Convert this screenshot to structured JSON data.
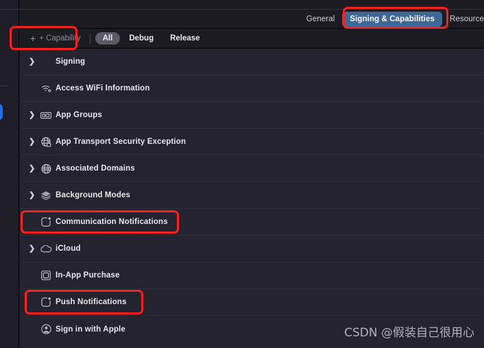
{
  "window": {
    "background_color": "#1c1b22",
    "list_background_color": "#24222e",
    "accent_blue": "#3f6795",
    "annotation_color": "#fb2020"
  },
  "tabbar": {
    "tabs": [
      {
        "label": "General",
        "active": false
      },
      {
        "label": "Signing & Capabilities",
        "active": true
      },
      {
        "label": "Resource",
        "active": false
      }
    ]
  },
  "filterbar": {
    "add_capability_label": "+ Capability",
    "filters": [
      {
        "label": "All",
        "selected": true
      },
      {
        "label": "Debug",
        "selected": false
      },
      {
        "label": "Release",
        "selected": false
      }
    ]
  },
  "capability_list": {
    "rows": [
      {
        "label": "Signing",
        "icon": "none",
        "disclosure": true,
        "highlighted": false
      },
      {
        "label": "Access WiFi Information",
        "icon": "wifi-icon",
        "disclosure": false,
        "highlighted": false
      },
      {
        "label": "App Groups",
        "icon": "app-groups-icon",
        "disclosure": true,
        "highlighted": false
      },
      {
        "label": "App Transport Security Exception",
        "icon": "globe-lock-icon",
        "disclosure": true,
        "highlighted": false
      },
      {
        "label": "Associated Domains",
        "icon": "globe-icon",
        "disclosure": true,
        "highlighted": false
      },
      {
        "label": "Background Modes",
        "icon": "layers-icon",
        "disclosure": true,
        "highlighted": false
      },
      {
        "label": "Communication Notifications",
        "icon": "notification-icon",
        "disclosure": false,
        "highlighted": true
      },
      {
        "label": "iCloud",
        "icon": "cloud-icon",
        "disclosure": true,
        "highlighted": false
      },
      {
        "label": "In-App Purchase",
        "icon": "in-app-purchase-icon",
        "disclosure": false,
        "highlighted": false
      },
      {
        "label": "Push Notifications",
        "icon": "notification-icon",
        "disclosure": false,
        "highlighted": true
      },
      {
        "label": "Sign in with Apple",
        "icon": "person-circle-icon",
        "disclosure": false,
        "highlighted": false
      }
    ]
  },
  "annotations": [
    {
      "name": "add-capability-highlight",
      "target": "+ Capability"
    },
    {
      "name": "signing-tab-highlight",
      "target": "Signing & Capabilities"
    },
    {
      "name": "communication-notifications-highlight",
      "target": "Communication Notifications"
    },
    {
      "name": "push-notifications-highlight",
      "target": "Push Notifications"
    }
  ],
  "watermark": {
    "text": "CSDN @假装自己很用心"
  }
}
